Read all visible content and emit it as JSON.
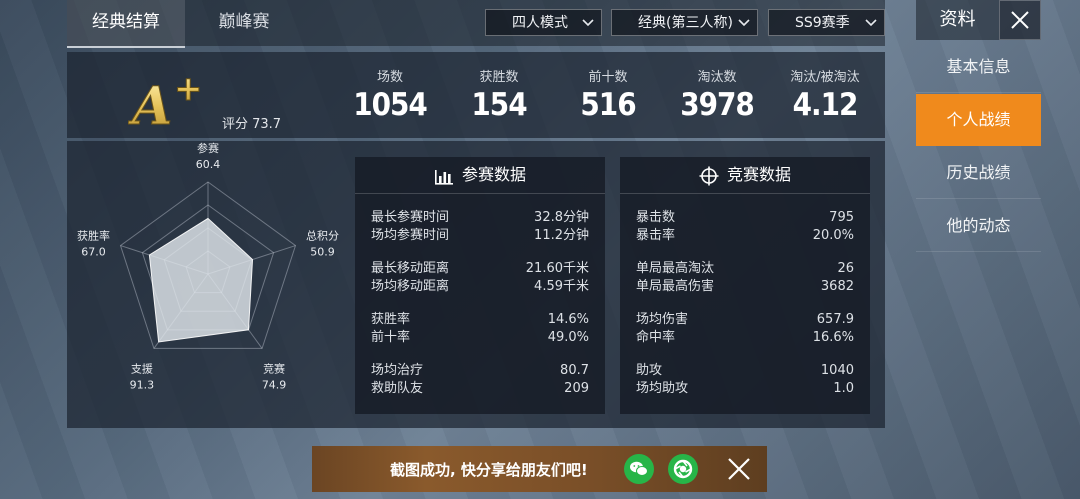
{
  "tabs": [
    {
      "label": "经典结算",
      "active": true
    },
    {
      "label": "巅峰赛",
      "active": false
    }
  ],
  "filters": {
    "mode": "四人模式",
    "view": "经典(第三人称)",
    "season": "SS9赛季"
  },
  "grade": {
    "letter": "A",
    "plus": "+",
    "score_label": "评分 73.7"
  },
  "stats": [
    {
      "label": "场数",
      "value": "1054"
    },
    {
      "label": "获胜数",
      "value": "154"
    },
    {
      "label": "前十数",
      "value": "516"
    },
    {
      "label": "淘汰数",
      "value": "3978"
    },
    {
      "label": "淘汰/被淘汰",
      "value": "4.12"
    }
  ],
  "radar": {
    "axes": [
      {
        "label": "参赛",
        "value": "60.4",
        "score": 60.4
      },
      {
        "label": "总积分",
        "value": "50.9",
        "score": 50.9
      },
      {
        "label": "竞赛",
        "value": "74.9",
        "score": 74.9
      },
      {
        "label": "支援",
        "value": "91.3",
        "score": 91.3
      },
      {
        "label": "获胜率",
        "value": "67.0",
        "score": 67.0
      }
    ]
  },
  "participation": {
    "title": "参赛数据",
    "rows": [
      {
        "k": "最长参赛时间",
        "v": "32.8分钟"
      },
      {
        "k": "场均参赛时间",
        "v": "11.2分钟"
      },
      {
        "k": "最长移动距离",
        "v": "21.60千米"
      },
      {
        "k": "场均移动距离",
        "v": "4.59千米"
      },
      {
        "k": "获胜率",
        "v": "14.6%"
      },
      {
        "k": "前十率",
        "v": "49.0%"
      },
      {
        "k": "场均治疗",
        "v": "80.7"
      },
      {
        "k": "救助队友",
        "v": "209"
      }
    ]
  },
  "competition": {
    "title": "竞赛数据",
    "rows": [
      {
        "k": "暴击数",
        "v": "795"
      },
      {
        "k": "暴击率",
        "v": "20.0%"
      },
      {
        "k": "单局最高淘汰",
        "v": "26"
      },
      {
        "k": "单局最高伤害",
        "v": "3682"
      },
      {
        "k": "场均伤害",
        "v": "657.9"
      },
      {
        "k": "命中率",
        "v": "16.6%"
      },
      {
        "k": "助攻",
        "v": "1040"
      },
      {
        "k": "场均助攻",
        "v": "1.0"
      }
    ]
  },
  "sidebar": {
    "title": "资料",
    "items": [
      {
        "label": "基本信息",
        "active": false
      },
      {
        "label": "个人战绩",
        "active": true
      },
      {
        "label": "历史战绩",
        "active": false
      },
      {
        "label": "他的动态",
        "active": false
      }
    ]
  },
  "toast": {
    "text": "截图成功, 快分享给朋友们吧!"
  },
  "colors": {
    "accent": "#f08a1c",
    "gold": "#e6c35a",
    "share_green": "#27b548"
  }
}
